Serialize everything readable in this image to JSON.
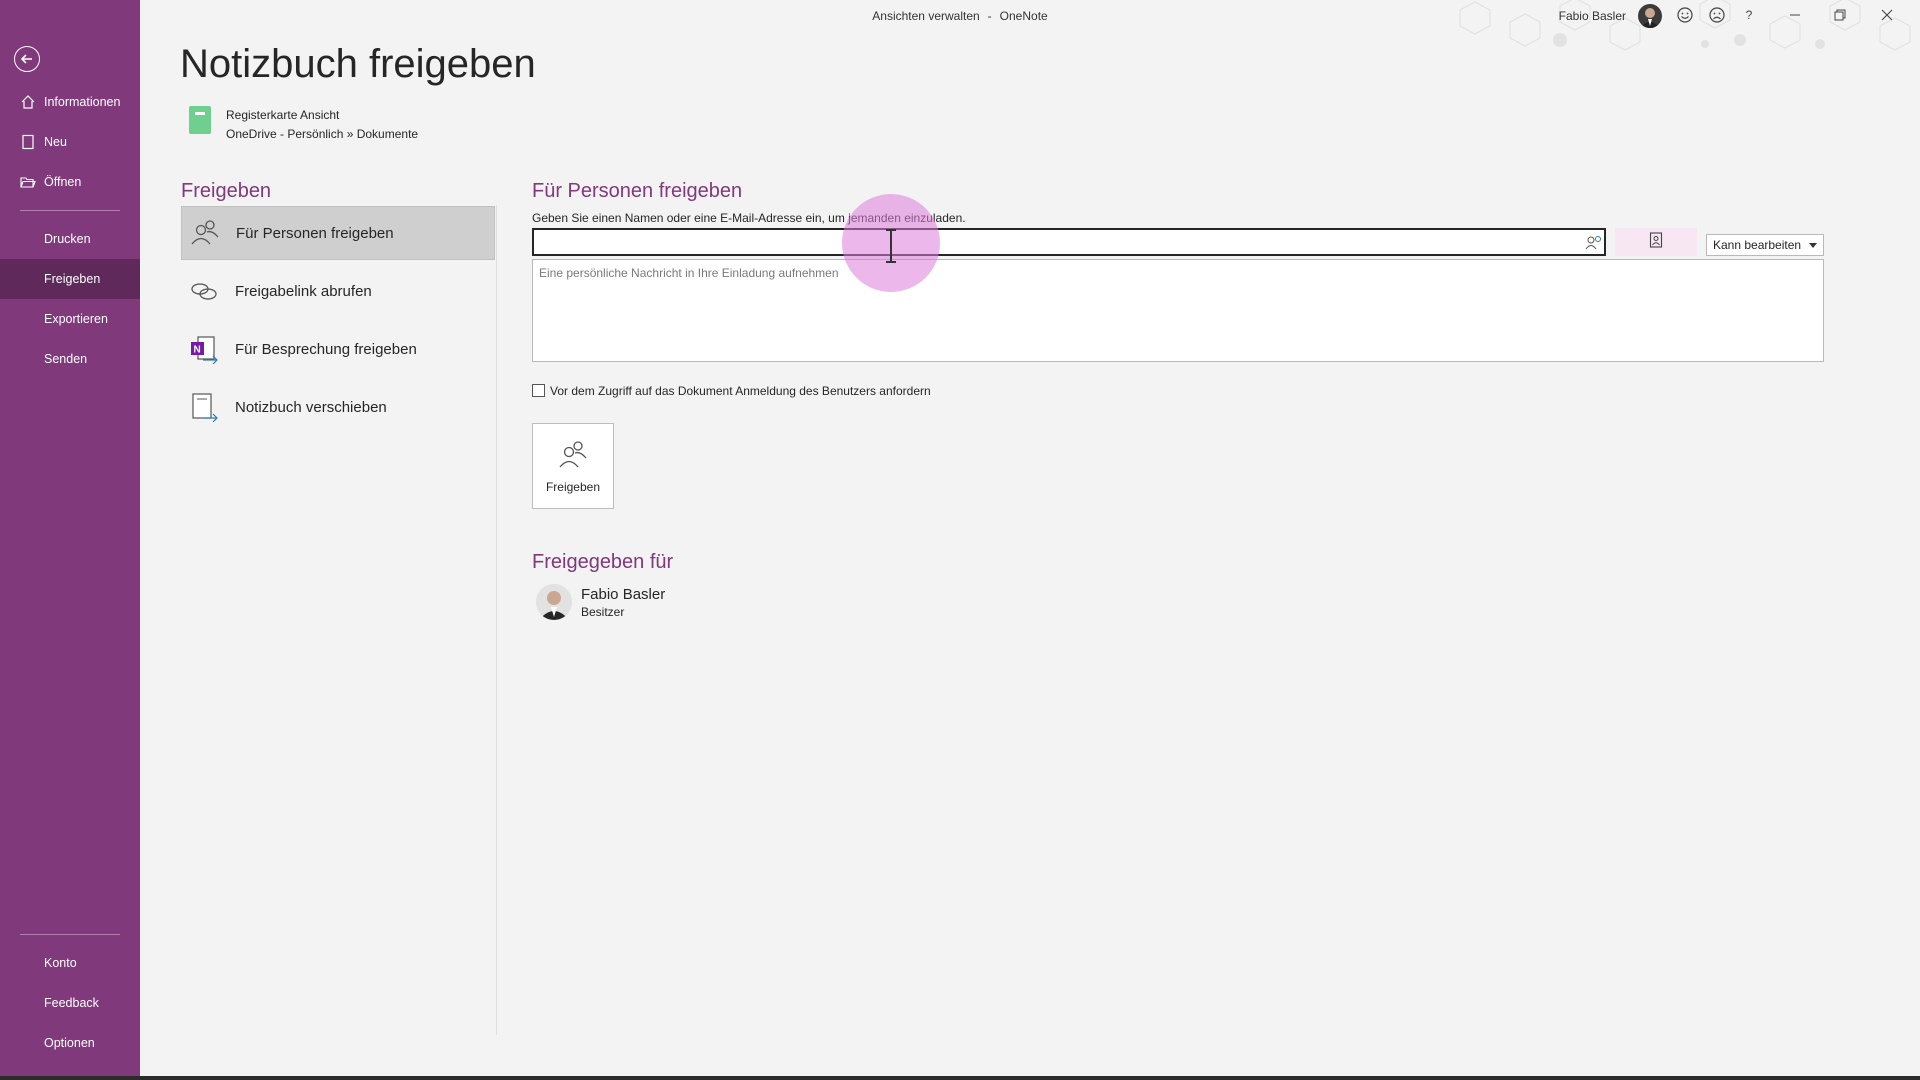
{
  "window": {
    "doc_title": "Ansichten verwalten",
    "separator": "-",
    "app_name": "OneNote",
    "user_name": "Fabio Basler",
    "help_label": "?"
  },
  "colors": {
    "brand": "#80397b",
    "sidebar_active": "#5f2a5b",
    "section_heading": "#80397b",
    "notebook_icon": "#6fcf8e"
  },
  "sidebar": {
    "items": [
      {
        "label": "Informationen",
        "icon": "home-icon"
      },
      {
        "label": "Neu",
        "icon": "new-page-icon"
      },
      {
        "label": "Öffnen",
        "icon": "folder-open-icon"
      },
      {
        "label": "Drucken"
      },
      {
        "label": "Freigeben",
        "active": true
      },
      {
        "label": "Exportieren"
      },
      {
        "label": "Senden"
      }
    ],
    "bottom_items": [
      {
        "label": "Konto"
      },
      {
        "label": "Feedback"
      },
      {
        "label": "Optionen"
      }
    ]
  },
  "page": {
    "title": "Notizbuch freigeben",
    "notebook_name": "Registerkarte Ansicht",
    "notebook_path": "OneDrive - Persönlich » Dokumente"
  },
  "share_menu": {
    "heading": "Freigeben",
    "options": [
      {
        "label": "Für Personen freigeben",
        "icon": "people-icon",
        "selected": true
      },
      {
        "label": "Freigabelink abrufen",
        "icon": "link-icon"
      },
      {
        "label": "Für Besprechung freigeben",
        "icon": "onenote-meeting-icon"
      },
      {
        "label": "Notizbuch verschieben",
        "icon": "move-notebook-icon"
      }
    ]
  },
  "invite": {
    "heading": "Für Personen freigeben",
    "instruction": "Geben Sie einen Namen oder eine E-Mail-Adresse ein, um jemanden einzuladen.",
    "input_value": "",
    "permission": "Kann bearbeiten",
    "message_placeholder": "Eine persönliche Nachricht in Ihre Einladung aufnehmen",
    "require_signin_label": "Vor dem Zugriff auf das Dokument Anmeldung des Benutzers anfordern",
    "require_signin_checked": false,
    "share_button": "Freigeben"
  },
  "shared_with": {
    "heading": "Freigegeben für",
    "people": [
      {
        "name": "Fabio Basler",
        "role": "Besitzer"
      }
    ]
  }
}
